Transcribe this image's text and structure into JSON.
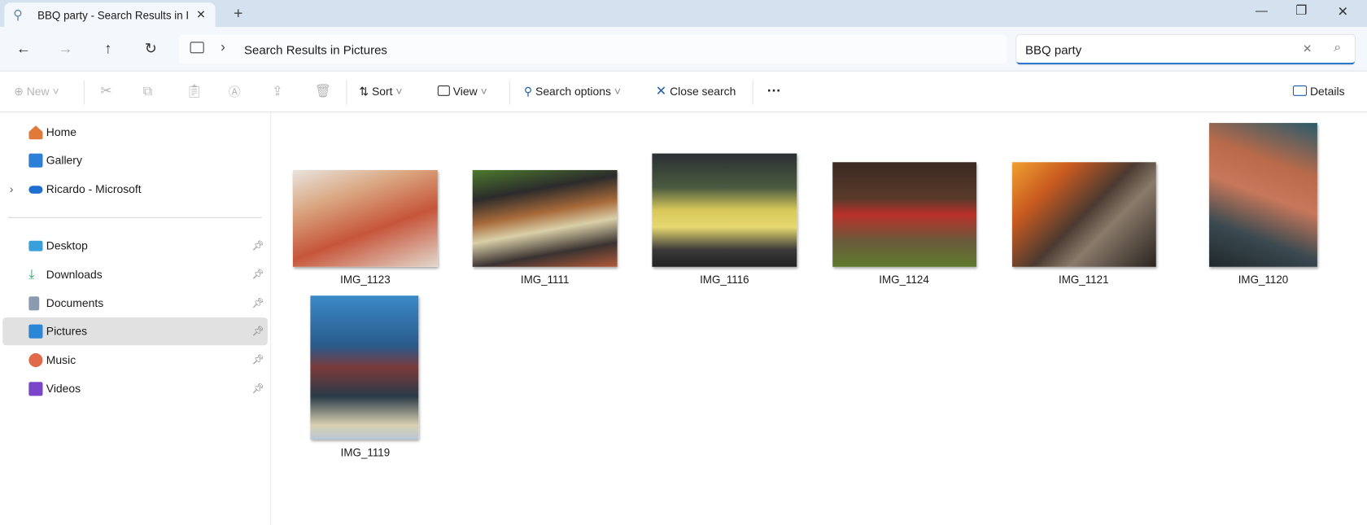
{
  "window": {
    "tab_title": "BBQ party - Search Results in I",
    "new_tab_label": "+",
    "controls": {
      "minimize": "—",
      "restore": "❐",
      "close": "✕"
    }
  },
  "nav": {
    "back": "←",
    "forward": "→",
    "up": "↑",
    "refresh": "↻",
    "breadcrumb_separator": "›",
    "location": "Search Results in Pictures",
    "search_value": "BBQ party",
    "search_clear": "✕",
    "search_icon": "⌕"
  },
  "toolbar": {
    "new_label": "New",
    "sort_label": "Sort",
    "view_label": "View",
    "search_options_label": "Search options",
    "close_search_label": "Close search",
    "more_label": "···",
    "details_label": "Details"
  },
  "sidebar": {
    "items": [
      {
        "label": "Home",
        "icon": "home-icon",
        "color": "#e07a3a"
      },
      {
        "label": "Gallery",
        "icon": "gallery-icon",
        "color": "#2b7fd6"
      },
      {
        "label": "Ricardo - Microsoft",
        "icon": "onedrive-icon",
        "color": "#1e6fd0"
      },
      {
        "label": "Desktop",
        "icon": "desktop-icon",
        "color": "#3aa0dc"
      },
      {
        "label": "Downloads",
        "icon": "downloads-icon",
        "color": "#2e9e6a"
      },
      {
        "label": "Documents",
        "icon": "documents-icon",
        "color": "#8a9bb0"
      },
      {
        "label": "Pictures",
        "icon": "pictures-icon",
        "color": "#2b86d6"
      },
      {
        "label": "Music",
        "icon": "music-icon",
        "color": "#e06a4a"
      },
      {
        "label": "Videos",
        "icon": "videos-icon",
        "color": "#7a45c8"
      }
    ],
    "pin_glyph": "📌",
    "expand_glyph": "›"
  },
  "files": [
    {
      "name": "IMG_1123"
    },
    {
      "name": "IMG_1111"
    },
    {
      "name": "IMG_1116"
    },
    {
      "name": "IMG_1124"
    },
    {
      "name": "IMG_1121"
    },
    {
      "name": "IMG_1120"
    },
    {
      "name": "IMG_1119"
    }
  ],
  "colors": {
    "accent": "#1f6fc4",
    "titlebar": "#d3e2ee",
    "selection": "#e1e1e1"
  }
}
